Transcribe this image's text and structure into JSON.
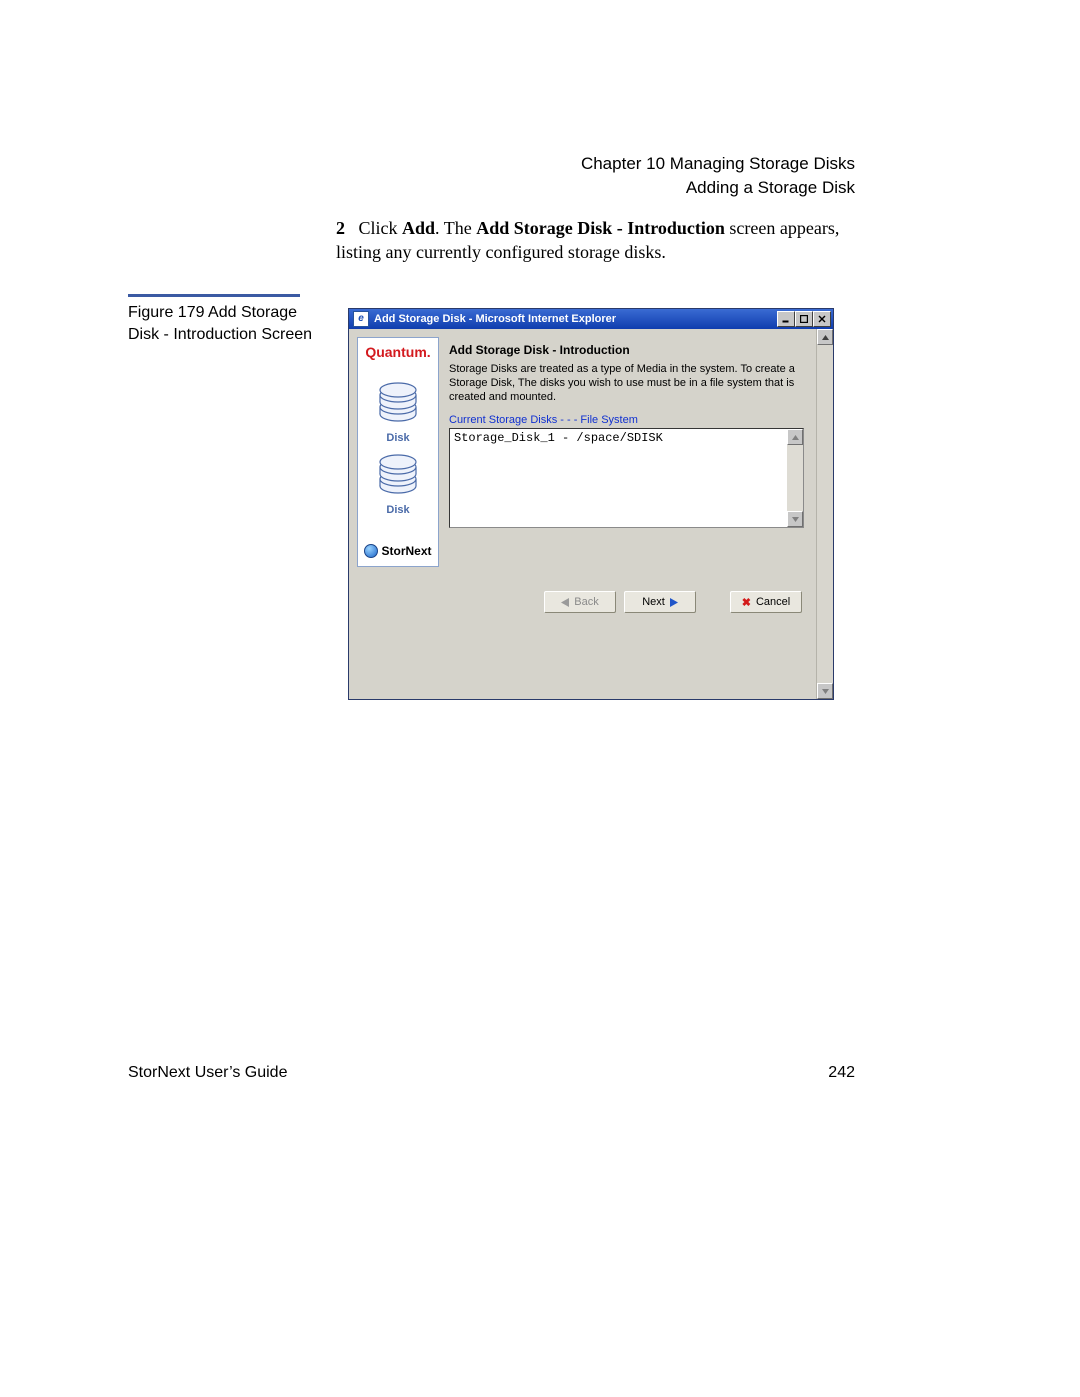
{
  "header": {
    "chapter_line": "Chapter 10  Managing Storage Disks",
    "section_line": "Adding a Storage Disk"
  },
  "instruction": {
    "number": "2",
    "text_pre": "Click ",
    "bold1": "Add",
    "text_mid1": ". The ",
    "bold2": "Add Storage Disk - Introduction",
    "text_mid2": " screen appears, listing any currently configured storage disks."
  },
  "caption": "Figure 179  Add Storage Disk - Introduction Screen",
  "footer": {
    "left": "StorNext User’s Guide",
    "right": "242"
  },
  "window": {
    "title": "Add Storage Disk - Microsoft Internet Explorer",
    "sidebar": {
      "brand": "Quantum.",
      "disk_label": "Disk",
      "product": "StorNext"
    },
    "main": {
      "heading": "Add Storage Disk - Introduction",
      "description": "Storage Disks are treated as a type of Media in the system. To create a Storage Disk, The disks you wish to use must be in a file system that is created and mounted.",
      "list_label": "Current Storage Disks - - - File System",
      "list_item": "Storage_Disk_1 - /space/SDISK"
    },
    "buttons": {
      "back": "Back",
      "next": "Next",
      "cancel": "Cancel"
    }
  }
}
